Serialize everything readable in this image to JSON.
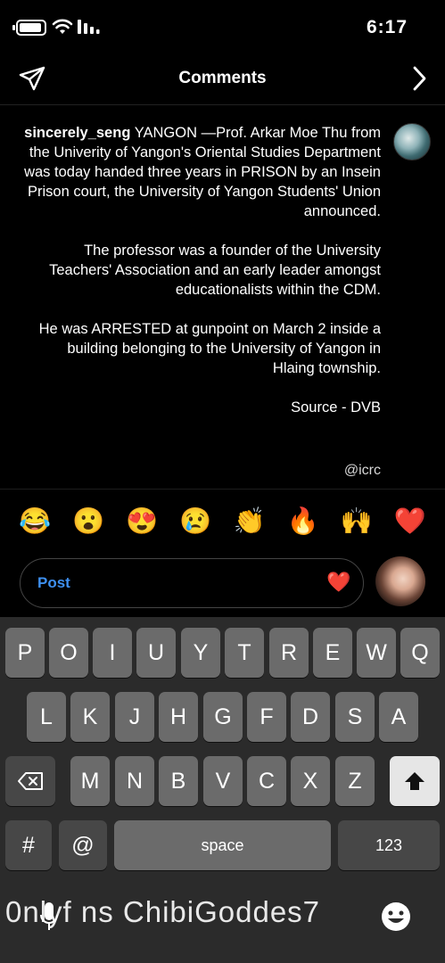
{
  "status_bar": {
    "time": "6:17"
  },
  "header": {
    "title": "Comments"
  },
  "comment": {
    "username": "sincerely_seng",
    "paragraphs": [
      "YANGON —Prof. Arkar Moe Thu from the Univerity of Yangon's Oriental Studies Department was today handed three years in PRISON by an Insein Prison court, the University of Yangon Students' Union announced.",
      "The professor was a founder of the University Teachers' Association and an early leader amongst educationalists within the CDM.",
      "He was ARRESTED at gunpoint on March 2 inside a building belonging to the University of Yangon in Hlaing township.",
      "Source - DVB"
    ],
    "mention": "@icrc"
  },
  "emojis": [
    {
      "name": "heart",
      "char": "❤️"
    },
    {
      "name": "raising-hands",
      "char": "🙌"
    },
    {
      "name": "fire",
      "char": "🔥"
    },
    {
      "name": "clapping",
      "char": "👏"
    },
    {
      "name": "crying",
      "char": "😢"
    },
    {
      "name": "heart-eyes",
      "char": "😍"
    },
    {
      "name": "surprised",
      "char": "😮"
    },
    {
      "name": "laughing",
      "char": "😂"
    }
  ],
  "input": {
    "post_label": "Post",
    "heart": "❤️"
  },
  "keyboard": {
    "row1": [
      "Q",
      "W",
      "E",
      "R",
      "T",
      "Y",
      "U",
      "I",
      "O",
      "P"
    ],
    "row2": [
      "A",
      "S",
      "D",
      "F",
      "G",
      "H",
      "J",
      "K",
      "L"
    ],
    "row3": [
      "Z",
      "X",
      "C",
      "V",
      "B",
      "N",
      "M"
    ],
    "numbers_label": "123",
    "space_label": "space",
    "at_label": "@",
    "hash_label": "#",
    "bottom_text": "0nlyf ns ChibiGoddes7"
  }
}
